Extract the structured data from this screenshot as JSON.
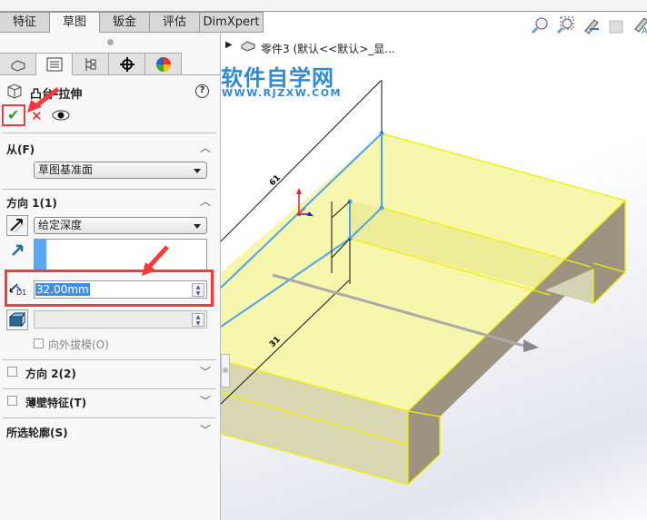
{
  "tabs": [
    "特征",
    "草图",
    "钣金",
    "评估",
    "DimXpert"
  ],
  "active_tab": "草图",
  "feature": {
    "title": "凸台-拉伸",
    "help": "?"
  },
  "from": {
    "label": "从(F)",
    "value": "草图基准面"
  },
  "dir1": {
    "label": "方向 1(1)",
    "end_condition": "给定深度",
    "depth": "32.00mm",
    "depth_icon_label": "D1",
    "draft_label": "向外拔模(O)"
  },
  "dir2": {
    "label": "方向 2(2)"
  },
  "thin": {
    "label": "薄壁特征(T)"
  },
  "contours": {
    "label": "所选轮廓(S)"
  },
  "tree": {
    "part": "零件3  (默认<<默认>_显..."
  },
  "watermark": {
    "title": "软件自学网",
    "url": "WWW.RJZXW.COM"
  },
  "colors": {
    "highlight": "#f43a3a",
    "accent": "#4da3f0",
    "face": "#f5f4a6"
  }
}
